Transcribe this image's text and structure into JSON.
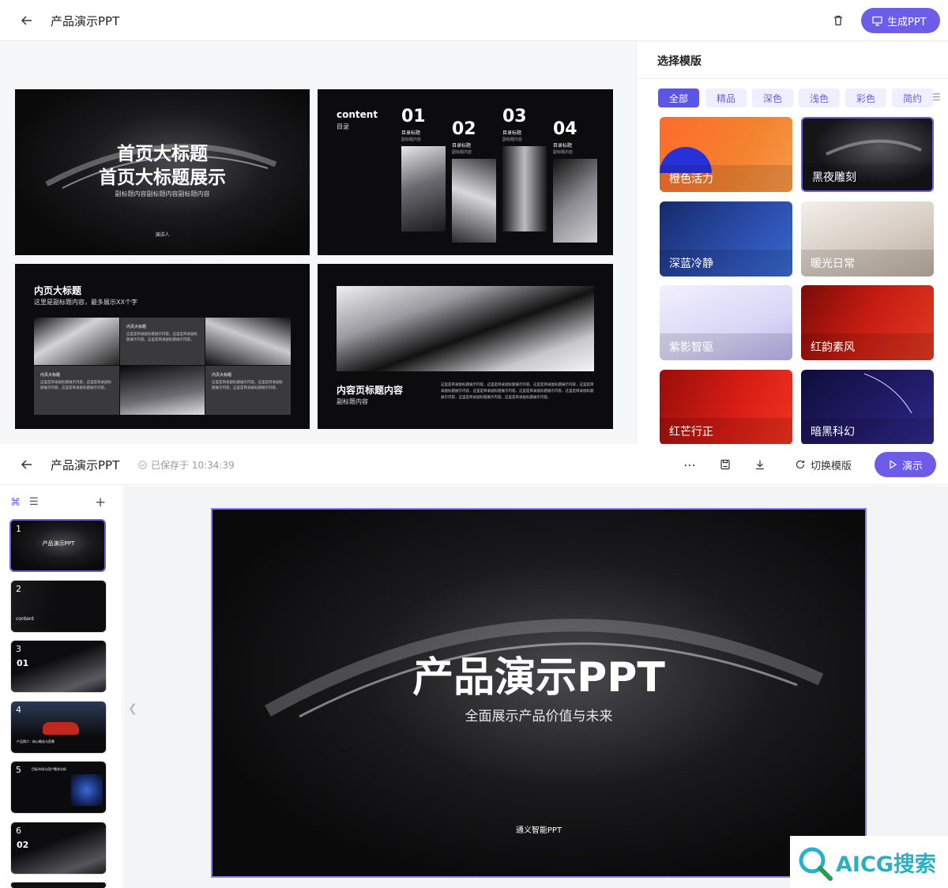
{
  "top_header": {
    "title": "产品演示PPT",
    "generate_label": "生成PPT"
  },
  "preview_slides": {
    "s1": {
      "title_line1": "首页大标题",
      "title_line2": "首页大标题展示",
      "subtitle": "副标题内容副标题内容副标题内容",
      "presenter": "演讲人"
    },
    "s2": {
      "label": "content",
      "sub": "目录",
      "items": [
        {
          "num": "01",
          "title": "目录标题",
          "sub": "副标题内容"
        },
        {
          "num": "02",
          "title": "目录标题",
          "sub": "副标题内容"
        },
        {
          "num": "03",
          "title": "目录标题",
          "sub": "副标题内容"
        },
        {
          "num": "04",
          "title": "目录标题",
          "sub": "副标题内容"
        }
      ]
    },
    "s3": {
      "title": "内页大标题",
      "sub": "这里是副标题内容，最多展示XX个字",
      "cell_title": "内页大标题",
      "cell_text": "这里是目录副标题展示内容，这里是目录副标题展示内容，这里是目录副标题展示内容。"
    },
    "s4": {
      "title": "内容页标题内容",
      "sub": "副标题内容",
      "body": "这里是目录副标题展示内容，这里是目录副标题展示内容，这里是目录副标题展示内容，这里是目录副标题展示内容，这里是目录副标题展示内容，这里是目录副标题展示内容，这里是目录副标题展示内容，这里是目录副标题展示内容，这里是目录副标题展示内容。"
    }
  },
  "template_panel": {
    "title": "选择模版",
    "tabs": [
      "全部",
      "精品",
      "深色",
      "浅色",
      "彩色",
      "简约"
    ],
    "templates": [
      {
        "label": "橙色活力",
        "color": "#f06a3a"
      },
      {
        "label": "黑夜雕刻",
        "color": "#15151a"
      },
      {
        "label": "深蓝冷静",
        "color": "#233f8f"
      },
      {
        "label": "暖光日常",
        "color": "#d9cfc6"
      },
      {
        "label": "紫影智驱",
        "color": "#c9c6f2"
      },
      {
        "label": "红韵素风",
        "color": "#b3170f"
      },
      {
        "label": "红芒行正",
        "color": "#c7150f"
      },
      {
        "label": "暗黑科幻",
        "color": "#1a1650"
      }
    ]
  },
  "editor": {
    "title": "产品演示PPT",
    "saved": "已保存于 10:34:39",
    "switch_label": "切换模版",
    "present_label": "演示"
  },
  "thumbnails": [
    {
      "num": "1",
      "text": "产品演示PPT"
    },
    {
      "num": "2",
      "text": "content"
    },
    {
      "num": "3",
      "text": "01"
    },
    {
      "num": "4",
      "text": "产品简介：核心概念与愿景"
    },
    {
      "num": "5",
      "text": "目标市场与用户需求分析"
    },
    {
      "num": "6",
      "text": "02"
    }
  ],
  "main_slide": {
    "title": "产品演示PPT",
    "subtitle": "全面展示产品价值与未来",
    "footer": "通义智能PPT"
  },
  "watermark": {
    "text": "AICG搜索"
  }
}
